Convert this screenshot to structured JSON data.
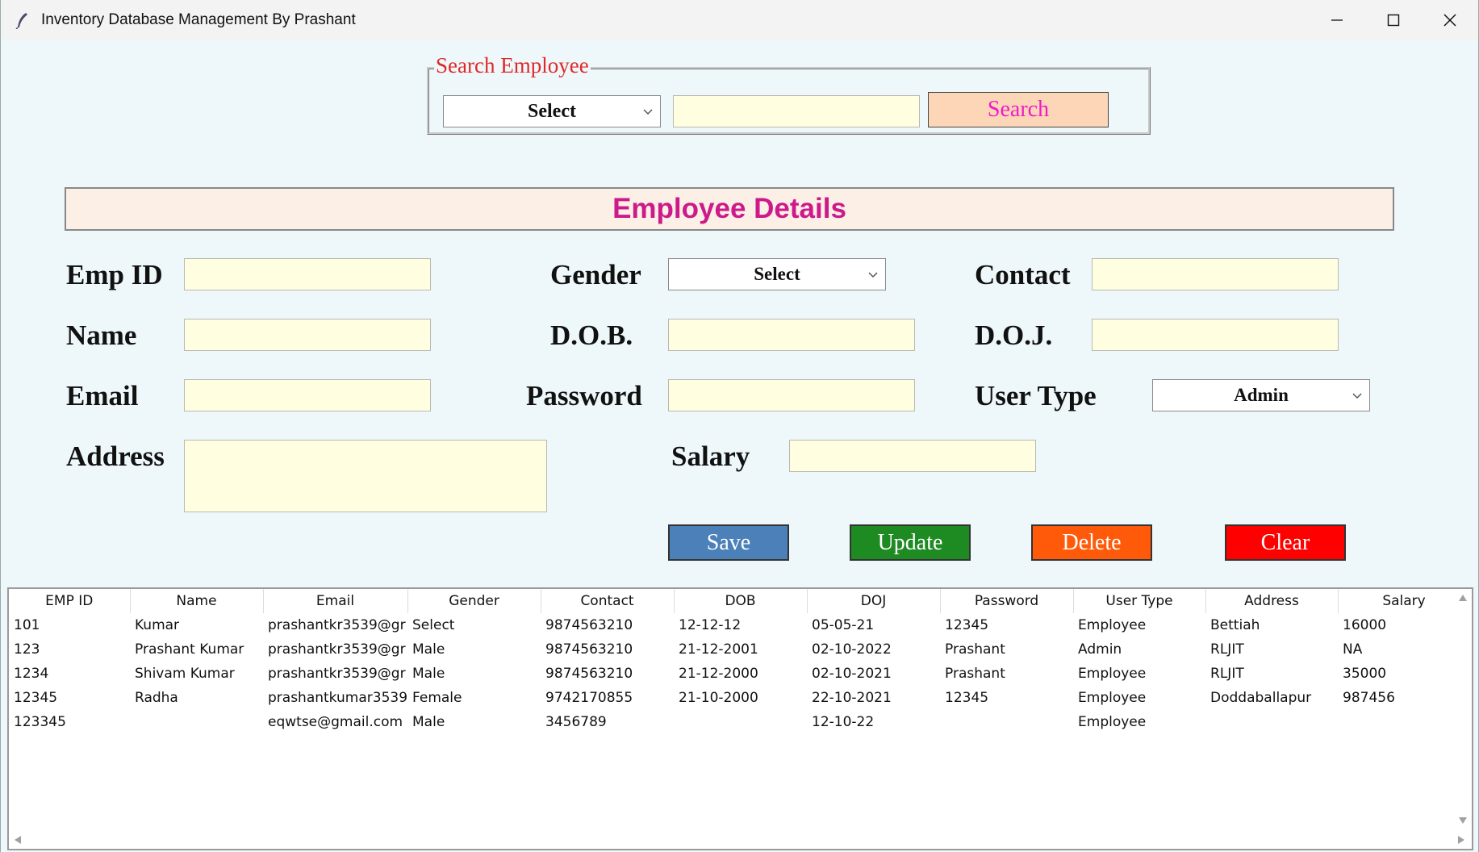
{
  "window": {
    "title": "Inventory Database Management By Prashant",
    "minimize_icon": "minimize-icon",
    "maximize_icon": "maximize-icon",
    "close_icon": "close-icon"
  },
  "search": {
    "legend": "Search Employee",
    "select_value": "Select",
    "text_value": "",
    "button_label": "Search"
  },
  "details": {
    "heading": "Employee Details",
    "labels": {
      "emp_id": "Emp ID",
      "name": "Name",
      "email": "Email",
      "address": "Address",
      "gender": "Gender",
      "dob": "D.O.B.",
      "password": "Password",
      "salary": "Salary",
      "contact": "Contact",
      "doj": "D.O.J.",
      "user_type": "User Type"
    },
    "gender_value": "Select",
    "user_type_value": "Admin"
  },
  "actions": {
    "save": "Save",
    "update": "Update",
    "delete": "Delete",
    "clear": "Clear"
  },
  "colors": {
    "save": "#4b80b8",
    "update": "#1e8a22",
    "delete": "#ff5a0a",
    "clear": "#ff0000",
    "entry_bg": "#fffee0",
    "heading": "#cc1a8b",
    "legend": "#e0282a"
  },
  "table": {
    "columns": [
      "EMP ID",
      "Name",
      "Email",
      "Gender",
      "Contact",
      "DOB",
      "DOJ",
      "Password",
      "User Type",
      "Address",
      "Salary"
    ],
    "rows": [
      [
        "101",
        "Kumar",
        "prashantkr3539@gr",
        "Select",
        "9874563210",
        "12-12-12",
        "05-05-21",
        "12345",
        "Employee",
        "Bettiah",
        "16000"
      ],
      [
        "123",
        "Prashant Kumar",
        "prashantkr3539@gr",
        "Male",
        "9874563210",
        "21-12-2001",
        "02-10-2022",
        "Prashant",
        "Admin",
        "RLJIT",
        "NA"
      ],
      [
        "1234",
        "Shivam Kumar",
        "prashantkr3539@gr",
        "Male",
        "9874563210",
        "21-12-2000",
        "02-10-2021",
        "Prashant",
        "Employee",
        "RLJIT",
        "35000"
      ],
      [
        "12345",
        "Radha",
        "prashantkumar3539",
        "Female",
        "9742170855",
        "21-10-2000",
        "22-10-2021",
        "12345",
        "Employee",
        "Doddaballapur",
        "987456"
      ],
      [
        "123345",
        "",
        "eqwtse@gmail.com",
        "Male",
        "3456789",
        "",
        "12-10-22",
        "",
        "Employee",
        "",
        ""
      ]
    ]
  }
}
